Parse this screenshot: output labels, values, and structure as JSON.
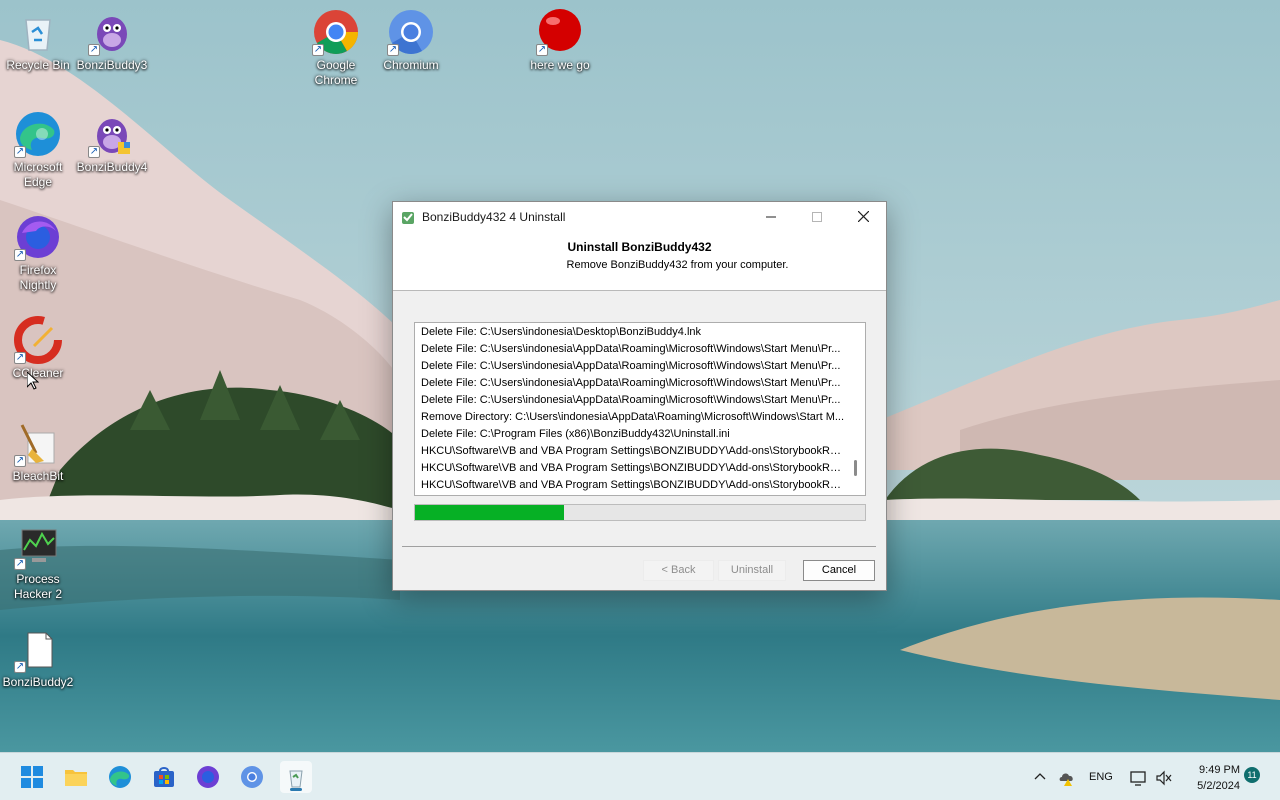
{
  "desktop": {
    "icons": [
      {
        "label": "Recycle Bin",
        "icon": "recycle-bin-icon"
      },
      {
        "label": "BonziBuddy3",
        "icon": "bonzibuddy-icon"
      },
      {
        "label": "Google Chrome",
        "icon": "chrome-icon"
      },
      {
        "label": "Chromium",
        "icon": "chromium-icon"
      },
      {
        "label": "here we go",
        "icon": "red-ball-icon"
      },
      {
        "label": "Microsoft Edge",
        "icon": "edge-icon"
      },
      {
        "label": "BonziBuddy4",
        "icon": "bonzibuddy-icon"
      },
      {
        "label": "Firefox Nightly",
        "icon": "firefox-nightly-icon"
      },
      {
        "label": "CCleaner",
        "icon": "ccleaner-icon"
      },
      {
        "label": "BleachBit",
        "icon": "bleachbit-icon"
      },
      {
        "label": "Process Hacker 2",
        "icon": "process-hacker-icon"
      },
      {
        "label": "BonziBuddy2",
        "icon": "file-icon"
      }
    ]
  },
  "dialog": {
    "title": "BonziBuddy432 4 Uninstall",
    "header_title": "Uninstall BonziBuddy432",
    "header_subtitle": "Remove BonziBuddy432 from your computer.",
    "log_lines": [
      "Delete File: C:\\Users\\indonesia\\Desktop\\BonziBuddy4.lnk",
      "Delete File: C:\\Users\\indonesia\\AppData\\Roaming\\Microsoft\\Windows\\Start Menu\\Pr...",
      "Delete File: C:\\Users\\indonesia\\AppData\\Roaming\\Microsoft\\Windows\\Start Menu\\Pr...",
      "Delete File: C:\\Users\\indonesia\\AppData\\Roaming\\Microsoft\\Windows\\Start Menu\\Pr...",
      "Delete File: C:\\Users\\indonesia\\AppData\\Roaming\\Microsoft\\Windows\\Start Menu\\Pr...",
      "Remove Directory: C:\\Users\\indonesia\\AppData\\Roaming\\Microsoft\\Windows\\Start M...",
      "Delete File: C:\\Program Files (x86)\\BonziBuddy432\\Uninstall.ini",
      "HKCU\\Software\\VB and VBA Program Settings\\BONZIBUDDY\\Add-ons\\StorybookRead...",
      "HKCU\\Software\\VB and VBA Program Settings\\BONZIBUDDY\\Add-ons\\StorybookRead...",
      "HKCU\\Software\\VB and VBA Program Settings\\BONZIBUDDY\\Add-ons\\StorybookRead..."
    ],
    "progress_percent": 33,
    "buttons": {
      "back": "< Back",
      "uninstall": "Uninstall",
      "cancel": "Cancel"
    }
  },
  "taskbar": {
    "apps": [
      "start-icon",
      "file-explorer-icon",
      "edge-icon",
      "store-icon",
      "firefox-nightly-icon",
      "chromium-icon",
      "uninstaller-icon"
    ],
    "language": "ENG",
    "time": "9:49 PM",
    "date": "5/2/2024",
    "notification_count": "11"
  },
  "colors": {
    "progress": "#06b025",
    "taskbar": "#e2eef1"
  }
}
